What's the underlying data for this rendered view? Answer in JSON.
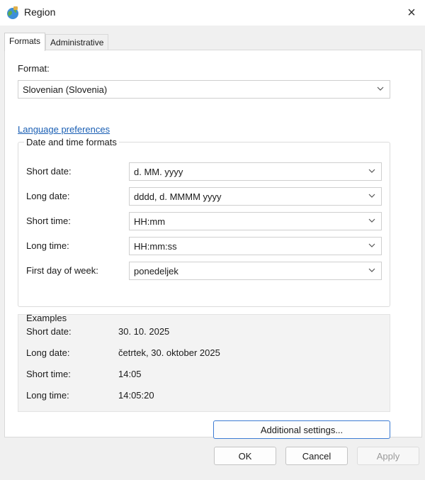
{
  "window": {
    "title": "Region",
    "close_symbol": "×",
    "icon": "globe-icon"
  },
  "tabs": [
    {
      "label": "Formats",
      "active": true
    },
    {
      "label": "Administrative",
      "active": false
    }
  ],
  "format": {
    "label": "Format:",
    "value": "Slovenian (Slovenia)"
  },
  "language_link": "Language preferences",
  "date_time_formats": {
    "legend": "Date and time formats",
    "rows": [
      {
        "label": "Short date:",
        "value": "d. MM. yyyy"
      },
      {
        "label": "Long date:",
        "value": "dddd, d. MMMM yyyy"
      },
      {
        "label": "Short time:",
        "value": "HH:mm"
      },
      {
        "label": "Long time:",
        "value": "HH:mm:ss"
      },
      {
        "label": "First day of week:",
        "value": "ponedeljek"
      }
    ]
  },
  "examples": {
    "legend": "Examples",
    "rows": [
      {
        "label": "Short date:",
        "value": "30. 10. 2025"
      },
      {
        "label": "Long date:",
        "value": "četrtek, 30. oktober 2025"
      },
      {
        "label": "Short time:",
        "value": "14:05"
      },
      {
        "label": "Long time:",
        "value": "14:05:20"
      }
    ]
  },
  "buttons": {
    "additional": "Additional settings...",
    "ok": "OK",
    "cancel": "Cancel",
    "apply": "Apply"
  },
  "colors": {
    "link": "#1a5fb4",
    "focus_border": "#3c7bd3",
    "dialog_bg": "#f0f0f0"
  }
}
